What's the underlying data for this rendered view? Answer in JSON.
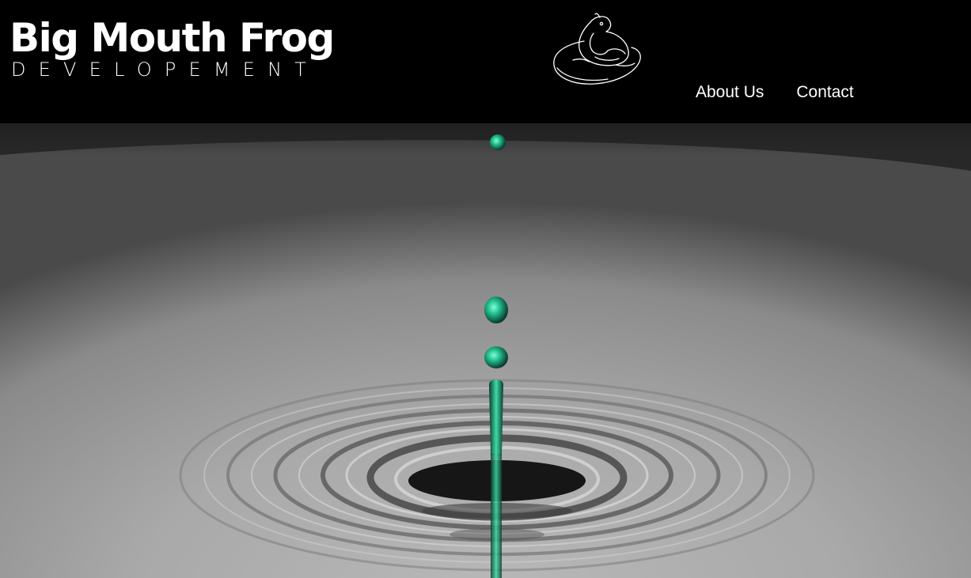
{
  "brand": {
    "title": "Big Mouth Frog",
    "subtitle": "DEVELOPEMENT",
    "logo_icon": "frog-outline-logo-icon"
  },
  "nav": {
    "items": [
      {
        "label": "About Us"
      },
      {
        "label": "Contact"
      }
    ]
  },
  "hero": {
    "image": "water-droplet-ripple-photo",
    "accent_color": "#1fb98a"
  },
  "colors": {
    "header_bg": "#000000",
    "text": "#ffffff"
  }
}
